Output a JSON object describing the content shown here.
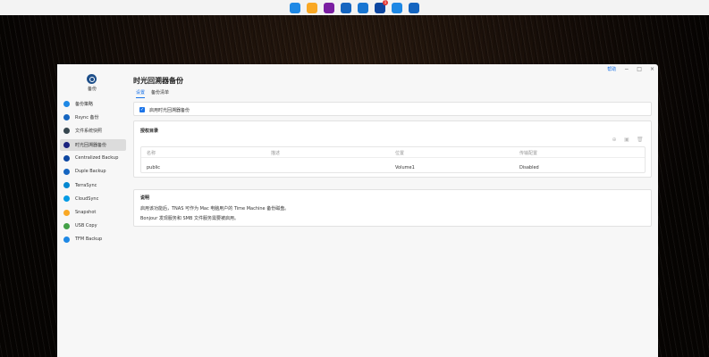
{
  "taskbar": {
    "icons": [
      {
        "name": "apps-grid-icon",
        "color": "#1e88e5"
      },
      {
        "name": "folder-icon",
        "color": "#f9a825"
      },
      {
        "name": "app-center-icon",
        "color": "#7b1fa2"
      },
      {
        "name": "time-machine-icon",
        "color": "#1565c0"
      },
      {
        "name": "settings-gear-icon",
        "color": "#1976d2"
      },
      {
        "name": "notes-icon",
        "color": "#0d47a1",
        "badge": "1"
      },
      {
        "name": "send-icon",
        "color": "#1e88e5"
      },
      {
        "name": "headset-icon",
        "color": "#1565c0"
      }
    ]
  },
  "window": {
    "help_label": "帮助",
    "minimize": "−",
    "maximize": "□",
    "close": "×"
  },
  "sidebar": {
    "app_name": "备份",
    "items": [
      {
        "label": "备份策略",
        "icon": "sync-icon",
        "color": "#1e88e5",
        "active": false
      },
      {
        "label": "Rsync 备份",
        "icon": "rsync-icon",
        "color": "#1565c0",
        "active": false
      },
      {
        "label": "文件系统快照",
        "icon": "snapshot-icon",
        "color": "#37474f",
        "active": false
      },
      {
        "label": "时光回溯器备份",
        "icon": "time-machine-icon",
        "color": "#1a237e",
        "active": true
      },
      {
        "label": "Centralized Backup",
        "icon": "centralized-backup-icon",
        "color": "#0d47a1",
        "active": false
      },
      {
        "label": "Duple Backup",
        "icon": "duple-backup-icon",
        "color": "#1565c0",
        "active": false
      },
      {
        "label": "TerraSync",
        "icon": "terrasync-icon",
        "color": "#0288d1",
        "active": false
      },
      {
        "label": "CloudSync",
        "icon": "cloudsync-icon",
        "color": "#039be5",
        "active": false
      },
      {
        "label": "Snapshot",
        "icon": "snapshot-cam-icon",
        "color": "#f9a825",
        "active": false
      },
      {
        "label": "USB Copy",
        "icon": "usb-copy-icon",
        "color": "#43a047",
        "active": false
      },
      {
        "label": "TFM Backup",
        "icon": "tfm-backup-icon",
        "color": "#1e88e5",
        "active": false
      }
    ]
  },
  "main": {
    "title": "时光回溯器备份",
    "tabs": [
      {
        "label": "设置",
        "active": true
      },
      {
        "label": "备份清单",
        "active": false
      }
    ],
    "enable_checkbox_label": "启用时光回溯器备份",
    "shared_folder": {
      "title": "授权目录",
      "columns": [
        "名称",
        "描述",
        "位置",
        "传输配置"
      ],
      "rows": [
        {
          "name": "public",
          "description": "",
          "location": "Volume1",
          "status": "Disabled"
        }
      ]
    },
    "description": {
      "title": "说明",
      "lines": [
        "启用该功能后，TNAS 可作为 Mac 电脑用户的 Time Machine 备份磁盘。",
        "Bonjour 发现服务和 SMB 文件服务需要被启用。"
      ]
    }
  }
}
